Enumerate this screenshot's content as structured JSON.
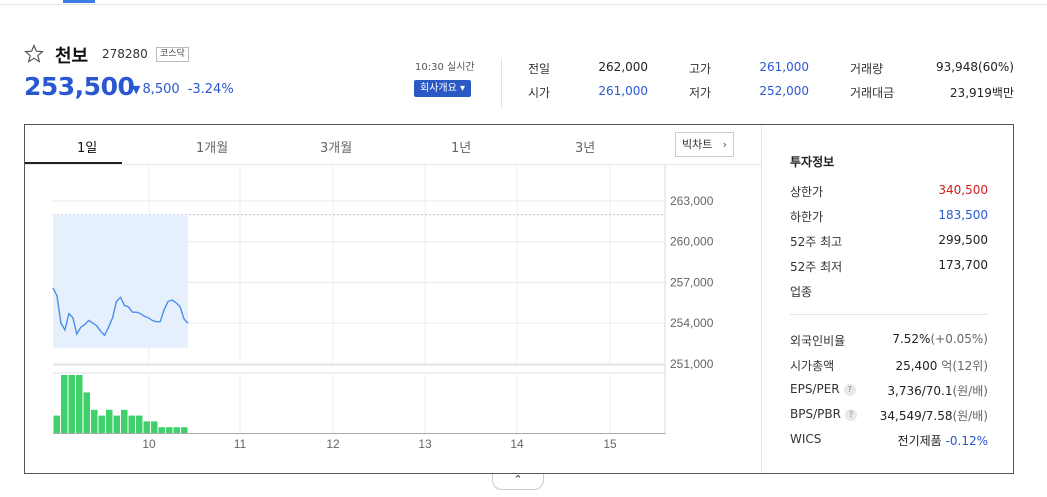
{
  "stock": {
    "name": "천보",
    "code": "278280",
    "market": "코스닥",
    "price": "253,500",
    "change": "8,500",
    "change_pct": "-3.24%",
    "realtime": "10:30 실시간",
    "company_button": "회사개요 ▾"
  },
  "summary": [
    {
      "label": "전일",
      "value": "262,000",
      "color": "#222222"
    },
    {
      "label": "고가",
      "value": "261,000",
      "color": "#2a58d0"
    },
    {
      "label": "거래량",
      "value": "93,948(60%)",
      "color": "#222222"
    },
    {
      "label": "시가",
      "value": "261,000",
      "color": "#2a58d0"
    },
    {
      "label": "저가",
      "value": "252,000",
      "color": "#2a58d0"
    },
    {
      "label": "거래대금",
      "value": "23,919백만",
      "color": "#222222"
    }
  ],
  "tabs": [
    "1일",
    "1개월",
    "3개월",
    "1년",
    "3년"
  ],
  "bigchart_label": "빅차트",
  "sidebar": {
    "title": "투자정보",
    "rows": [
      {
        "label": "상한가",
        "value": "340,500"
      },
      {
        "label": "하한가",
        "value": "183,500"
      },
      {
        "label": "52주 최고",
        "value": "299,500"
      },
      {
        "label": "52주 최저",
        "value": "173,700"
      },
      {
        "label": "업종",
        "value": ""
      }
    ],
    "rows2": [
      {
        "label": "외국인비율",
        "value": "7.52%",
        "sub": "(+0.05%)"
      },
      {
        "label": "시가총액",
        "value": "25,400",
        "sub": "억(12위)"
      },
      {
        "label": "EPS/PER",
        "value": "3,736/70.1",
        "sub": "(원/배)"
      },
      {
        "label": "BPS/PBR",
        "value": "34,549/7.58",
        "sub": "(원/배)"
      },
      {
        "label": "WICS",
        "value": "전기제품",
        "sub": "-0.12%"
      }
    ]
  },
  "colors": {
    "down": "#2a58d0",
    "up": "#d31d1d",
    "volume": "#3fcf6b",
    "line": "#4a8ee8",
    "area": "#e6f0fd"
  },
  "chart_data": {
    "type": "line",
    "x_ticks": [
      "10",
      "11",
      "12",
      "13",
      "14",
      "15"
    ],
    "y_ticks": [
      "263,000",
      "260,000",
      "257,000",
      "254,000",
      "251,000"
    ],
    "ylim": [
      251000,
      263000
    ],
    "reference_line": 262000,
    "series": [
      {
        "values": [
          256600,
          256000,
          254000,
          253500,
          254700,
          254400,
          253200,
          253700,
          253900,
          254200,
          254000,
          253800,
          253400,
          253100,
          253700,
          254400,
          255600,
          255900,
          255300,
          255200,
          254800,
          254800,
          254700,
          254500,
          254400,
          254200,
          254100,
          254100,
          255000,
          255600,
          255700,
          255500,
          255200,
          254300,
          254000
        ]
      }
    ],
    "volume": [
      3,
      10,
      10,
      10,
      7,
      4,
      3,
      4,
      3,
      4,
      3,
      3,
      2,
      2,
      1,
      1,
      1,
      1
    ]
  }
}
